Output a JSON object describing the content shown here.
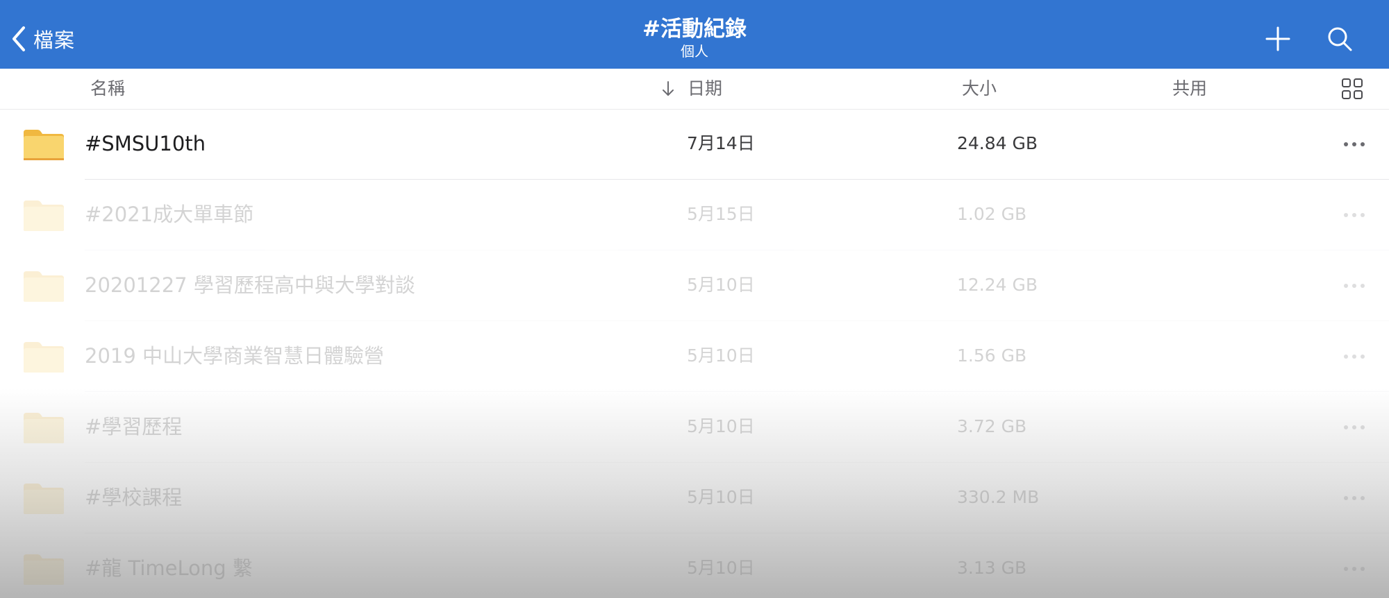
{
  "colors": {
    "header_bg": "#3275d1",
    "folder_yellow": "#f7cd63",
    "folder_tab": "#f0b840"
  },
  "header": {
    "back_label": "檔案",
    "title": "#活動紀錄",
    "subtitle": "個人",
    "add_icon": "plus-icon",
    "search_icon": "search-icon"
  },
  "columns": {
    "name": "名稱",
    "sort_icon": "arrow-down-icon",
    "date": "日期",
    "size": "大小",
    "shared": "共用",
    "view_toggle_icon": "grid-view-icon"
  },
  "files": [
    {
      "name": "#SMSU10th",
      "date": "7月14日",
      "size": "24.84 GB",
      "icon": "folder-icon"
    },
    {
      "name": "#2021成大單車節",
      "date": "5月15日",
      "size": "1.02 GB",
      "icon": "folder-icon"
    },
    {
      "name": "20201227 學習歷程高中與大學對談",
      "date": "5月10日",
      "size": "12.24 GB",
      "icon": "folder-icon"
    },
    {
      "name": "2019 中山大學商業智慧日體驗營",
      "date": "5月10日",
      "size": "1.56 GB",
      "icon": "folder-icon"
    },
    {
      "name": "#學習歷程",
      "date": "5月10日",
      "size": "3.72 GB",
      "icon": "folder-icon"
    },
    {
      "name": "#學校課程",
      "date": "5月10日",
      "size": "330.2 MB",
      "icon": "folder-icon"
    },
    {
      "name": "#龍 TimeLong 繫",
      "date": "5月10日",
      "size": "3.13 GB",
      "icon": "folder-icon"
    }
  ]
}
